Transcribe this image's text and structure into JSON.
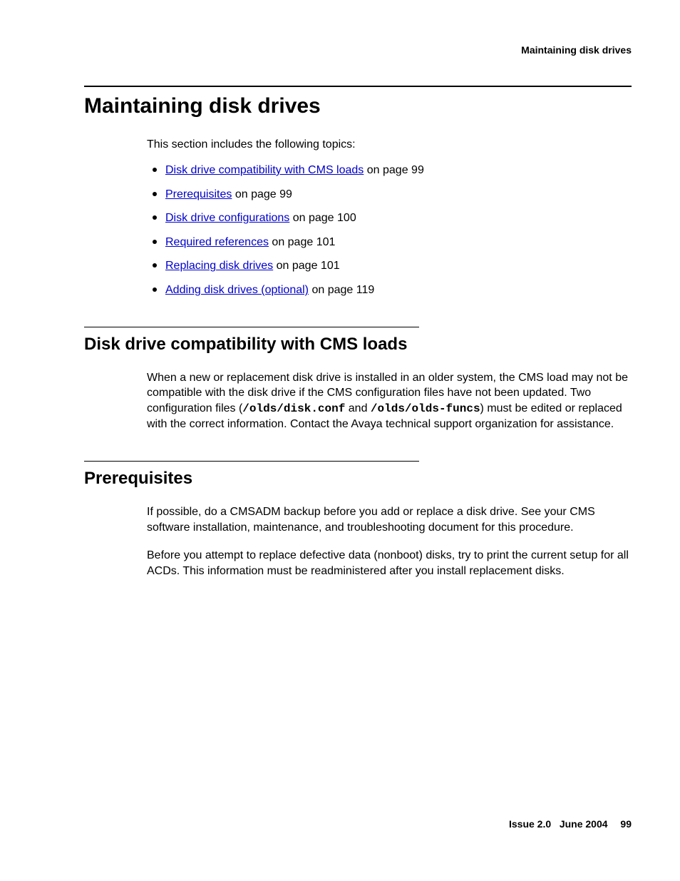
{
  "header": {
    "running_title": "Maintaining disk drives"
  },
  "title": "Maintaining disk drives",
  "intro": "This section includes the following topics:",
  "topics": [
    {
      "link": "Disk drive compatibility with CMS loads",
      "suffix": " on page 99"
    },
    {
      "link": "Prerequisites",
      "suffix": " on page 99"
    },
    {
      "link": "Disk drive configurations",
      "suffix": " on page 100"
    },
    {
      "link": "Required references",
      "suffix": " on page 101"
    },
    {
      "link": "Replacing disk drives",
      "suffix": " on page 101"
    },
    {
      "link": "Adding disk drives (optional)",
      "suffix": " on page 119"
    }
  ],
  "sections": {
    "compat": {
      "title": "Disk drive compatibility with CMS loads",
      "p1a": "When a new or replacement disk drive is installed in an older system, the CMS load may not be compatible with the disk drive if the CMS configuration files have not been updated. Two configuration files (",
      "code1": "/olds/disk.conf",
      "p1b": " and ",
      "code2": "/olds/olds-funcs",
      "p1c": ") must be edited or replaced with the correct information. Contact the Avaya technical support organization for assistance."
    },
    "prereq": {
      "title": "Prerequisites",
      "p1": "If possible, do a CMSADM backup before you add or replace a disk drive. See your CMS software installation, maintenance, and troubleshooting document for this procedure.",
      "p2": "Before you attempt to replace defective data (nonboot) disks, try to print the current setup for all ACDs. This information must be readministered after you install replacement disks."
    }
  },
  "footer": {
    "issue": "Issue 2.0",
    "date": "June 2004",
    "page": "99"
  }
}
